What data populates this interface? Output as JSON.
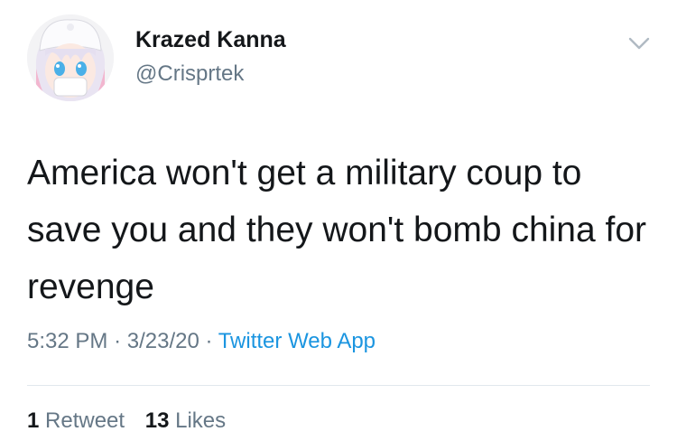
{
  "author": {
    "display_name": "Krazed Kanna",
    "handle": "@Crisprtek",
    "avatar_icon": "anime-character-avatar-icon"
  },
  "menu": {
    "icon": "chevron-down-icon"
  },
  "tweet": {
    "text": "America won't get a military coup to save you and they won't bomb china for revenge"
  },
  "meta": {
    "time": "5:32 PM",
    "date": "3/23/20",
    "separator": "·",
    "source": "Twitter Web App"
  },
  "stats": {
    "retweets_count": "1",
    "retweets_label": "Retweet",
    "likes_count": "13",
    "likes_label": "Likes"
  },
  "colors": {
    "text": "#14171a",
    "secondary": "#657786",
    "link": "#1b95e0",
    "divider": "#e1e8ed"
  }
}
